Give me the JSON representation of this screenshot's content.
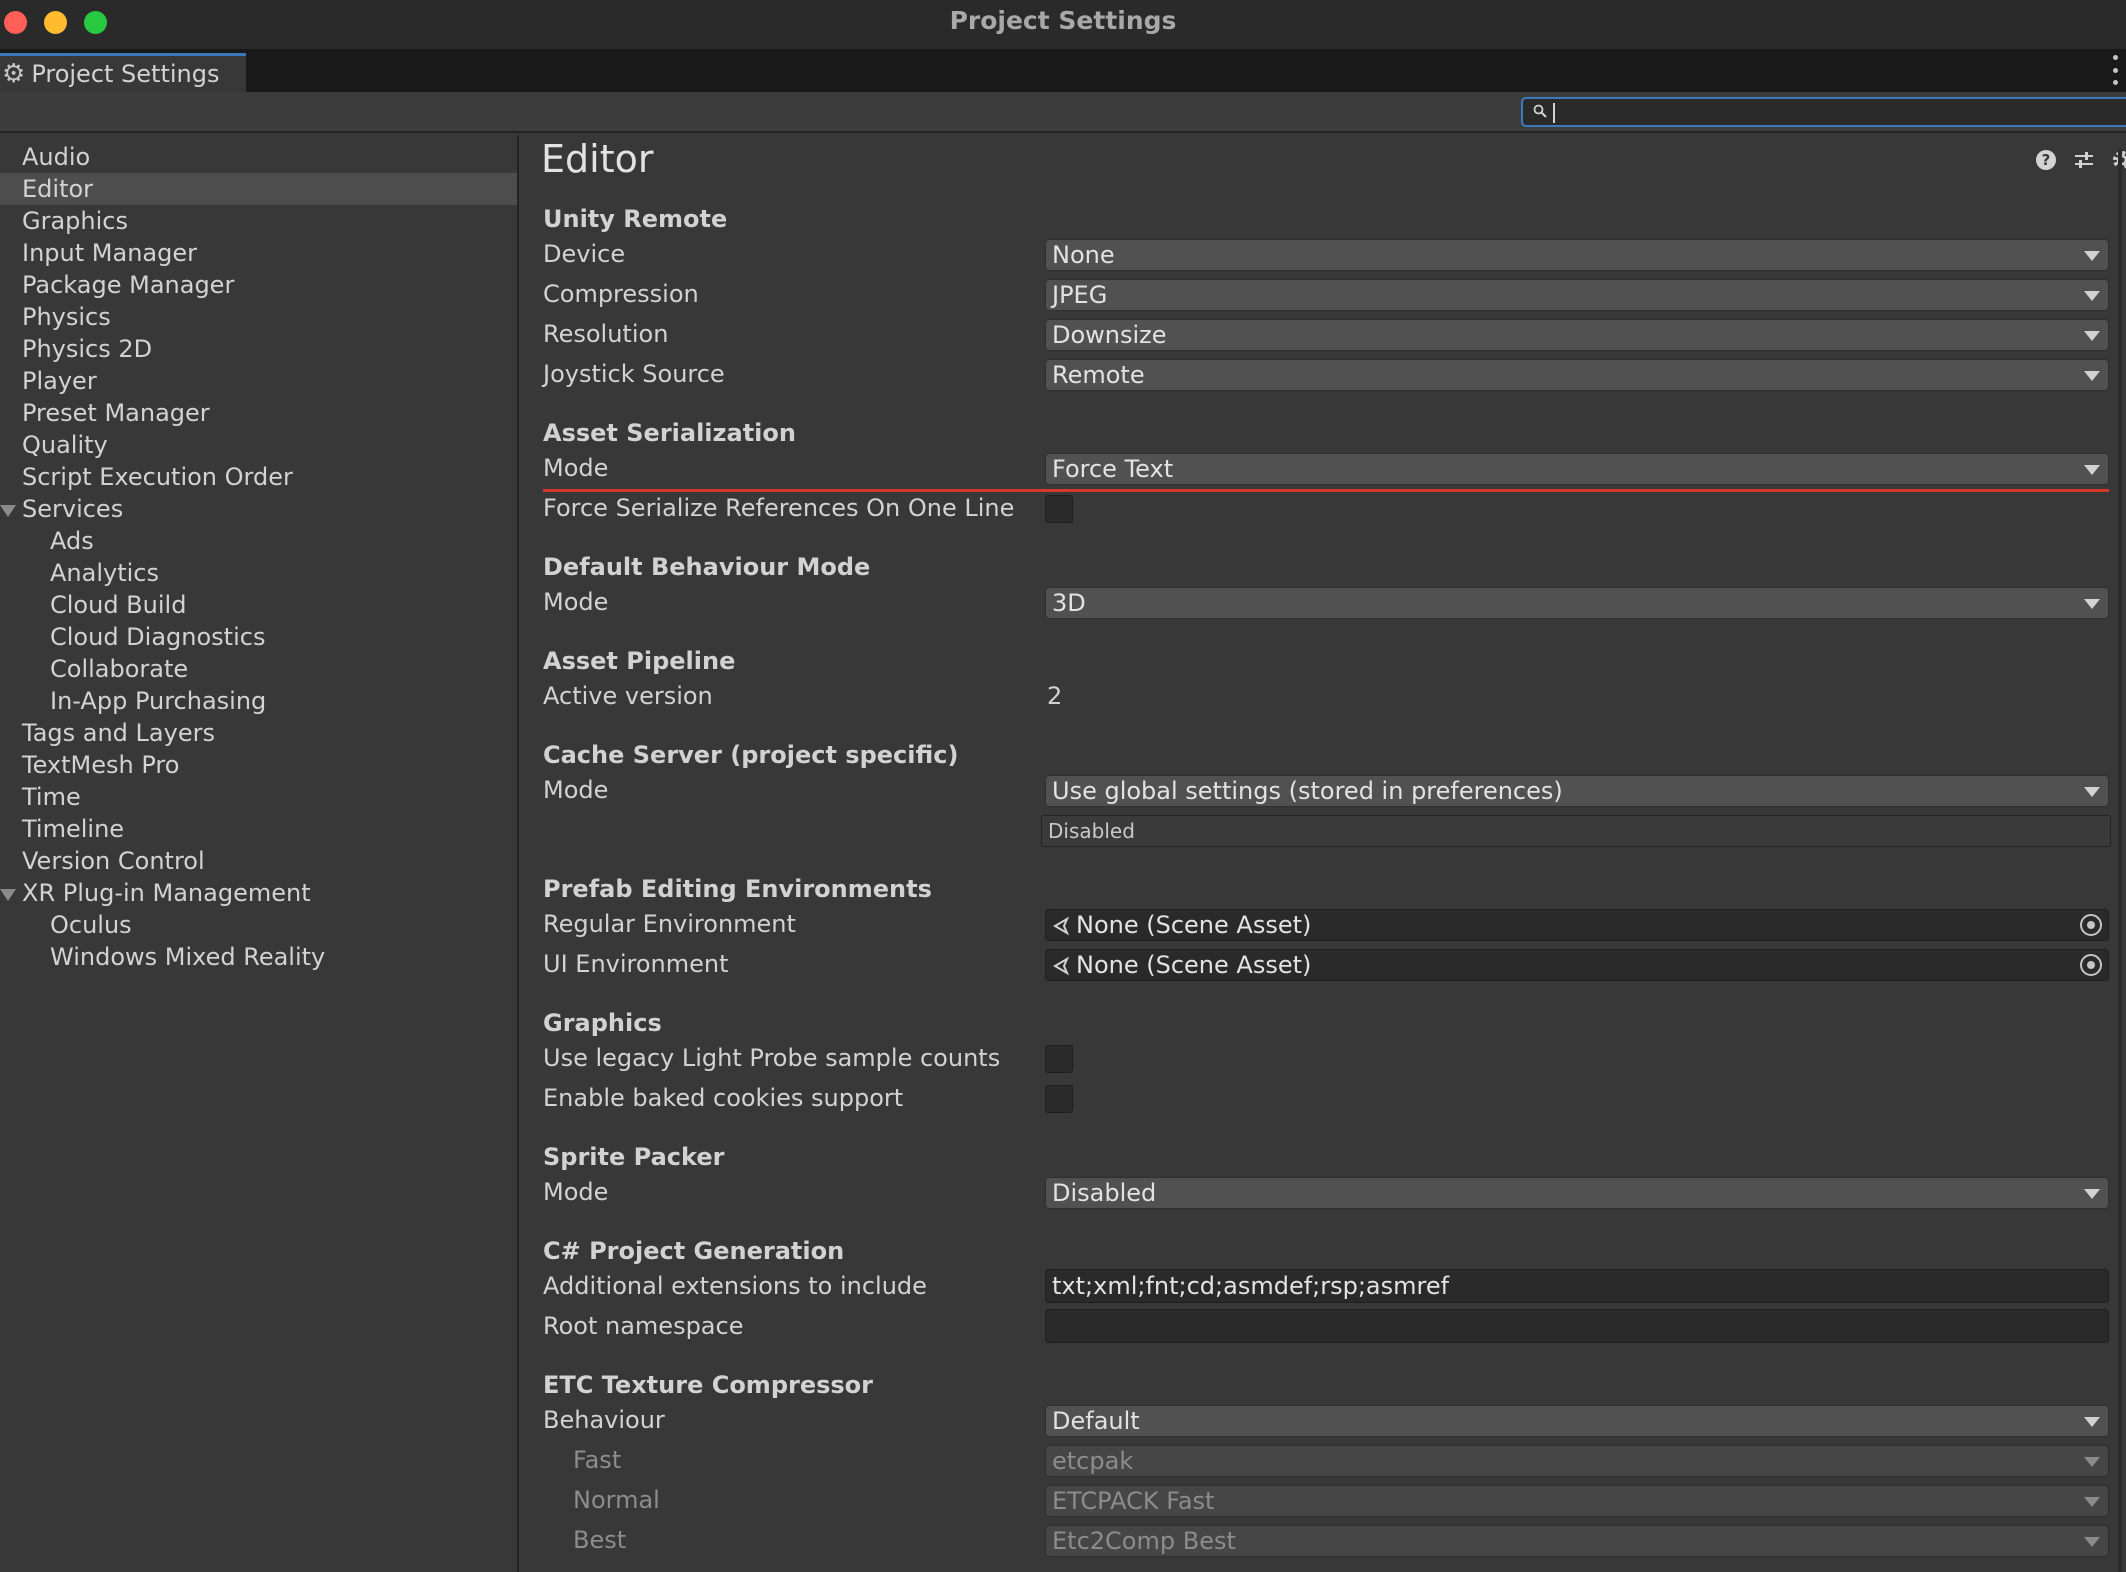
{
  "window": {
    "title": "Project Settings"
  },
  "tab": {
    "label": "Project Settings",
    "icon": "gear-icon"
  },
  "search": {
    "value": "",
    "icon": "search-icon"
  },
  "sidebar": {
    "items": [
      {
        "label": "Audio"
      },
      {
        "label": "Editor",
        "selected": true
      },
      {
        "label": "Graphics"
      },
      {
        "label": "Input Manager"
      },
      {
        "label": "Package Manager"
      },
      {
        "label": "Physics"
      },
      {
        "label": "Physics 2D"
      },
      {
        "label": "Player"
      },
      {
        "label": "Preset Manager"
      },
      {
        "label": "Quality"
      },
      {
        "label": "Script Execution Order"
      },
      {
        "label": "Services",
        "expanded": true
      },
      {
        "label": "Ads",
        "child": true
      },
      {
        "label": "Analytics",
        "child": true
      },
      {
        "label": "Cloud Build",
        "child": true
      },
      {
        "label": "Cloud Diagnostics",
        "child": true
      },
      {
        "label": "Collaborate",
        "child": true
      },
      {
        "label": "In-App Purchasing",
        "child": true
      },
      {
        "label": "Tags and Layers"
      },
      {
        "label": "TextMesh Pro"
      },
      {
        "label": "Time"
      },
      {
        "label": "Timeline"
      },
      {
        "label": "Version Control"
      },
      {
        "label": "XR Plug-in Management",
        "expanded": true
      },
      {
        "label": "Oculus",
        "child": true
      },
      {
        "label": "Windows Mixed Reality",
        "child": true
      }
    ]
  },
  "editor": {
    "title": "Editor",
    "header_icons": [
      "help-icon",
      "preset-icon",
      "settings-icon"
    ],
    "unity_remote": {
      "heading": "Unity Remote",
      "device": {
        "label": "Device",
        "value": "None"
      },
      "compression": {
        "label": "Compression",
        "value": "JPEG"
      },
      "resolution": {
        "label": "Resolution",
        "value": "Downsize"
      },
      "joystick_source": {
        "label": "Joystick Source",
        "value": "Remote"
      }
    },
    "asset_serialization": {
      "heading": "Asset Serialization",
      "mode": {
        "label": "Mode",
        "value": "Force Text"
      },
      "force_serialize": {
        "label": "Force Serialize References On One Line",
        "checked": false
      }
    },
    "default_behaviour": {
      "heading": "Default Behaviour Mode",
      "mode": {
        "label": "Mode",
        "value": "3D"
      }
    },
    "asset_pipeline": {
      "heading": "Asset Pipeline",
      "active_version": {
        "label": "Active version",
        "value": "2"
      }
    },
    "cache_server": {
      "heading": "Cache Server (project specific)",
      "mode": {
        "label": "Mode",
        "value": "Use global settings (stored in preferences)"
      },
      "status": "Disabled"
    },
    "prefab_editing": {
      "heading": "Prefab Editing Environments",
      "regular": {
        "label": "Regular Environment",
        "value": "None (Scene Asset)"
      },
      "ui": {
        "label": "UI Environment",
        "value": "None (Scene Asset)"
      }
    },
    "graphics": {
      "heading": "Graphics",
      "legacy_light_probe": {
        "label": "Use legacy Light Probe sample counts",
        "checked": false
      },
      "baked_cookies": {
        "label": "Enable baked cookies support",
        "checked": false
      }
    },
    "sprite_packer": {
      "heading": "Sprite Packer",
      "mode": {
        "label": "Mode",
        "value": "Disabled"
      }
    },
    "csharp_project": {
      "heading": "C# Project Generation",
      "extensions": {
        "label": "Additional extensions to include",
        "value": "txt;xml;fnt;cd;asmdef;rsp;asmref"
      },
      "root_namespace": {
        "label": "Root namespace",
        "value": ""
      }
    },
    "etc_compressor": {
      "heading": "ETC Texture Compressor",
      "behaviour": {
        "label": "Behaviour",
        "value": "Default"
      },
      "fast": {
        "label": "Fast",
        "value": "etcpak"
      },
      "normal": {
        "label": "Normal",
        "value": "ETCPACK Fast"
      },
      "best": {
        "label": "Best",
        "value": "Etc2Comp Best"
      }
    }
  },
  "colors": {
    "accent": "#3a79bb",
    "highlight_line": "#d2382b",
    "panel": "#383838"
  }
}
